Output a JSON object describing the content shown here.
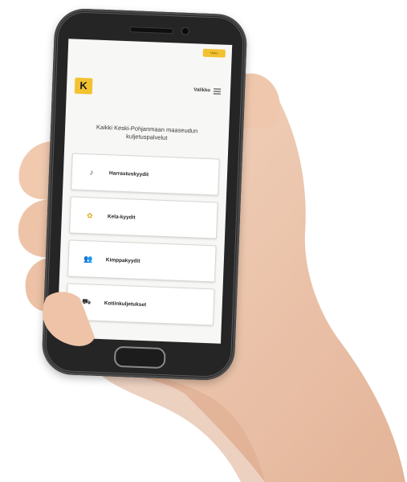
{
  "app": {
    "top_badge": "Haku",
    "logo_mark": "K",
    "menu_label": "Valikko",
    "headline": "Kaikki Keski-Pohjanmaan maaseudun kuljetuspalvelut",
    "services": [
      {
        "label": "Harrastuskyydit",
        "icon": "hobby-icon"
      },
      {
        "label": "Kela-kyydit",
        "icon": "kela-icon"
      },
      {
        "label": "Kimppakyydit",
        "icon": "carpool-icon"
      },
      {
        "label": "Kotiinkuljetukset",
        "icon": "delivery-icon"
      }
    ]
  },
  "colors": {
    "accent": "#f2c232",
    "phone_body": "#252525",
    "screen_bg": "#f7f7f5",
    "skin": "#efc9b0"
  }
}
